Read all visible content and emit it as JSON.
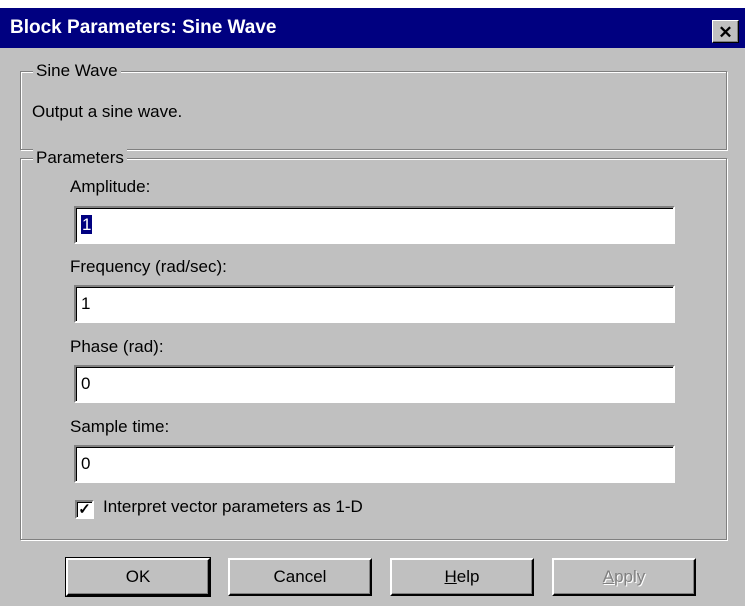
{
  "window": {
    "title": "Block Parameters: Sine Wave",
    "close_glyph": "✕"
  },
  "block": {
    "group_label": "Sine Wave",
    "description": "Output a sine wave."
  },
  "parameters": {
    "group_label": "Parameters",
    "amplitude_label": "Amplitude:",
    "amplitude_value": "1",
    "frequency_label": "Frequency (rad/sec):",
    "frequency_value": "1",
    "phase_label": "Phase (rad):",
    "phase_value": "0",
    "sample_time_label": "Sample time:",
    "sample_time_value": "0",
    "interpret_vector_label": "Interpret vector parameters as 1-D",
    "interpret_vector_checked": true,
    "check_glyph": "✓"
  },
  "buttons": {
    "ok": "OK",
    "cancel": "Cancel",
    "help_mnemonic": "H",
    "help_rest": "elp",
    "apply_mnemonic": "A",
    "apply_rest": "pply"
  },
  "colors": {
    "titlebar": "#000080",
    "dialog_face": "#c0c0c0",
    "selection": "#000080"
  }
}
